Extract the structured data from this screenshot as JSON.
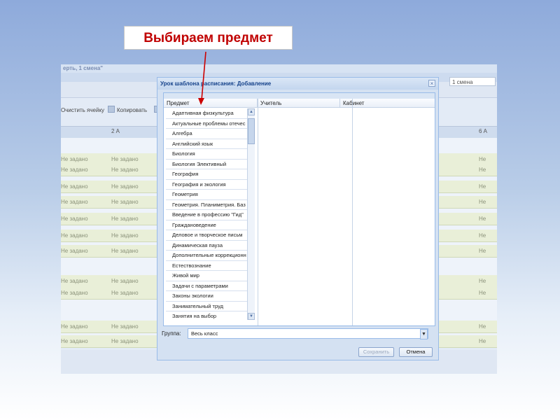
{
  "slide": {
    "callout": "Выбираем предмет",
    "callout_color": "#c00000"
  },
  "background_app": {
    "title": "ерть, 1 смена\"",
    "shift": "1 смена",
    "toolbar": {
      "clear": "Очистить ячейку",
      "copy": "Копировать"
    },
    "columns": {
      "left": "2 А",
      "right": "6 А"
    },
    "cell_placeholder": "Не задано"
  },
  "dialog": {
    "title": "Урок шаблона расписания: Добавление",
    "columns": {
      "subject": "Предмет",
      "teacher": "Учитель",
      "room": "Кабинет"
    },
    "subjects": [
      "Адаптивная физкультура",
      "Актуальные проблемы отечес",
      "Алгебра",
      "Английский язык",
      "Биология",
      "Биология Элективный",
      "География",
      "География и экология",
      "Геометрия",
      "Геометрия. Планиметрия. Баз",
      "Введение в профессию \"Гид\"",
      "Граждановедение",
      "Деловое и творческое письм",
      "Динамическая пауза",
      "Дополнительные коррекционн",
      "Естествознание",
      "Живой мир",
      "Задачи с параметрами",
      "Законы экологии",
      "Занимательный труд",
      "Занятия на выбор"
    ],
    "group": {
      "label": "Группа:",
      "value": "Весь класс"
    },
    "buttons": {
      "save": "Сохранить",
      "cancel": "Отмена"
    }
  }
}
